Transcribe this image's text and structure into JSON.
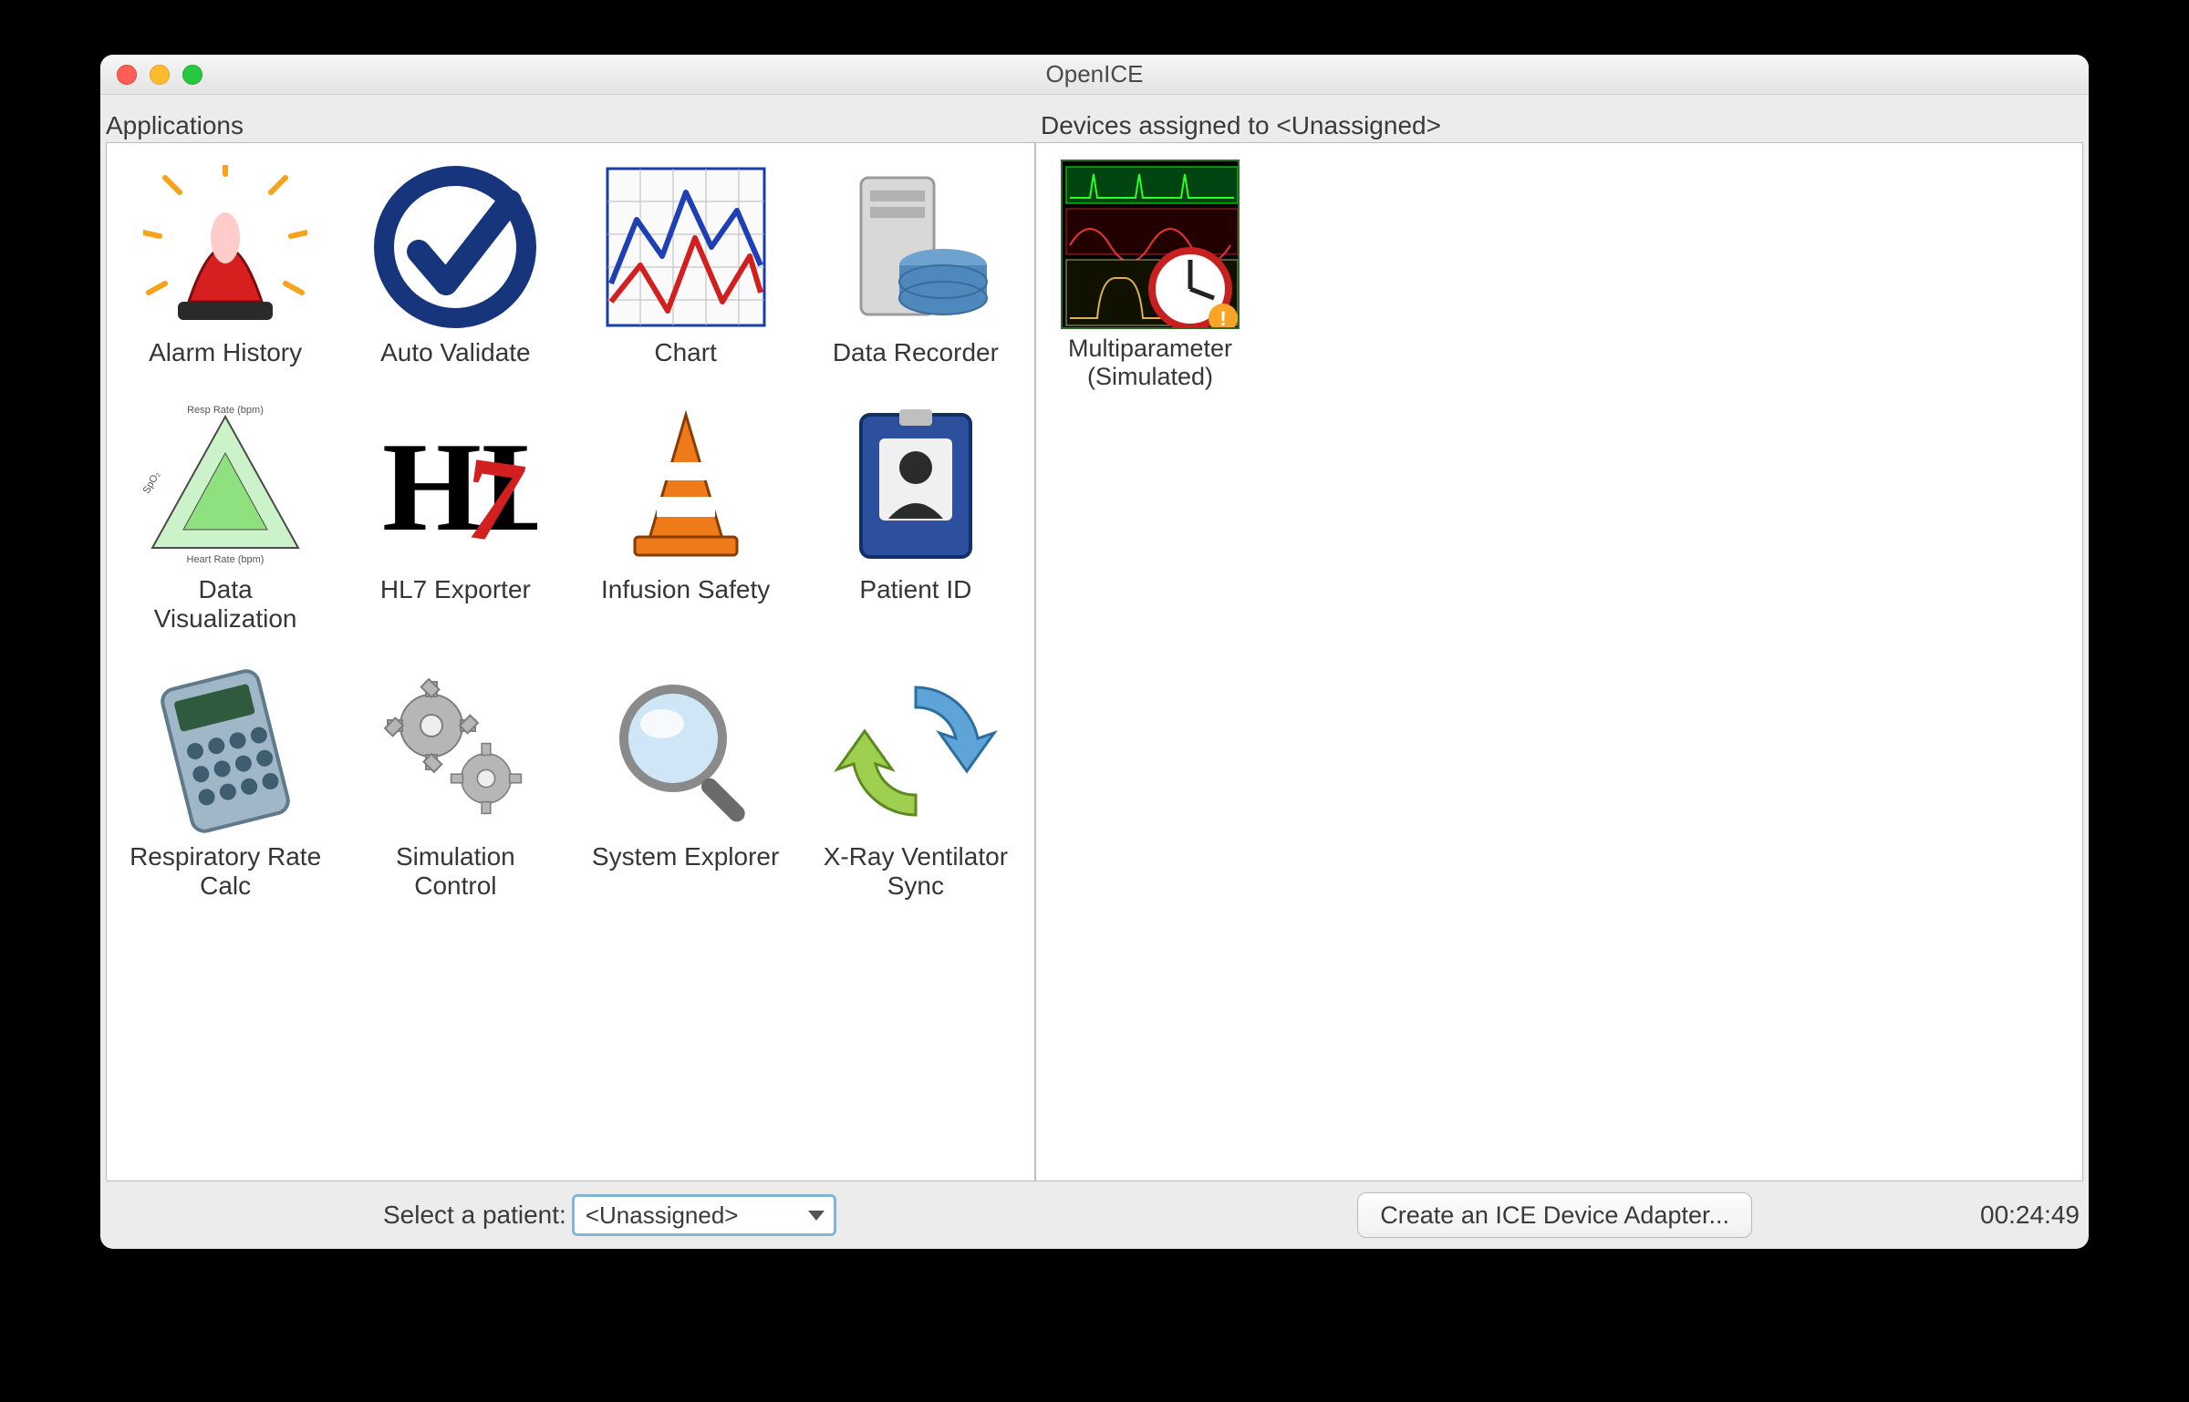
{
  "window": {
    "title": "OpenICE"
  },
  "sections": {
    "applications_label": "Applications",
    "devices_label": "Devices assigned to <Unassigned>"
  },
  "applications": [
    {
      "id": "alarm-history",
      "label": "Alarm History",
      "icon": "alarm-beacon"
    },
    {
      "id": "auto-validate",
      "label": "Auto Validate",
      "icon": "check-circle"
    },
    {
      "id": "chart",
      "label": "Chart",
      "icon": "line-chart"
    },
    {
      "id": "data-recorder",
      "label": "Data Recorder",
      "icon": "database-server"
    },
    {
      "id": "data-visualization",
      "label": "Data\nVisualization",
      "icon": "triangle-plot"
    },
    {
      "id": "hl7-exporter",
      "label": "HL7 Exporter",
      "icon": "hl7"
    },
    {
      "id": "infusion-safety",
      "label": "Infusion Safety",
      "icon": "traffic-cone"
    },
    {
      "id": "patient-id",
      "label": "Patient ID",
      "icon": "id-card"
    },
    {
      "id": "respiratory-rate-calc",
      "label": "Respiratory Rate\nCalc",
      "icon": "calculator"
    },
    {
      "id": "simulation-control",
      "label": "Simulation\nControl",
      "icon": "gears"
    },
    {
      "id": "system-explorer",
      "label": "System Explorer",
      "icon": "magnifier"
    },
    {
      "id": "xray-ventilator-sync",
      "label": "X-Ray Ventilator\nSync",
      "icon": "sync-arrows"
    }
  ],
  "devices": [
    {
      "id": "multiparameter-simulated",
      "label": "Multiparameter\n(Simulated)",
      "icon": "waveform-clock"
    }
  ],
  "footer": {
    "select_patient_label": "Select a patient:",
    "selected_patient": "<Unassigned>",
    "create_adapter_label": "Create an ICE Device Adapter...",
    "clock": "00:24:49"
  }
}
